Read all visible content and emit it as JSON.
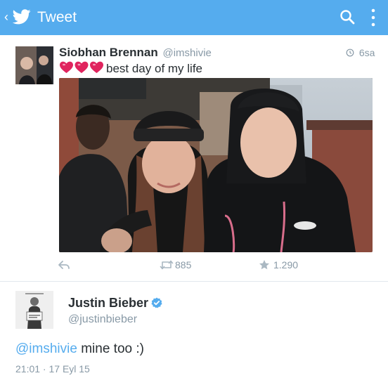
{
  "app_bar": {
    "title": "Tweet",
    "back_glyph": "‹",
    "icons": [
      "back-chevron-icon",
      "twitter-bird-icon",
      "search-icon",
      "more-vertical-icon"
    ],
    "background": "#55acee"
  },
  "quoted_tweet": {
    "name": "Siobhan Brennan",
    "handle": "@imshivie",
    "time": "6sa",
    "text": "best day of my life",
    "hearts": [
      "heart-emoji-icon",
      "heart-emoji-icon",
      "heart-emoji-icon"
    ],
    "retweets": "885",
    "favorites": "1.290",
    "icons": [
      "reply-icon",
      "retweet-icon",
      "star-icon",
      "clock-icon"
    ]
  },
  "main_tweet": {
    "name": "Justin Bieber",
    "handle": "@justinbieber",
    "mention": "@imshivie",
    "text": " mine too :)",
    "timestamp": "21:01 · 17 Eyl 15",
    "icons": [
      "verified-badge-icon"
    ]
  },
  "colors": {
    "accent": "#55acee",
    "text": "#292f33",
    "muted": "#8899a6",
    "heart": "#e0245e"
  }
}
